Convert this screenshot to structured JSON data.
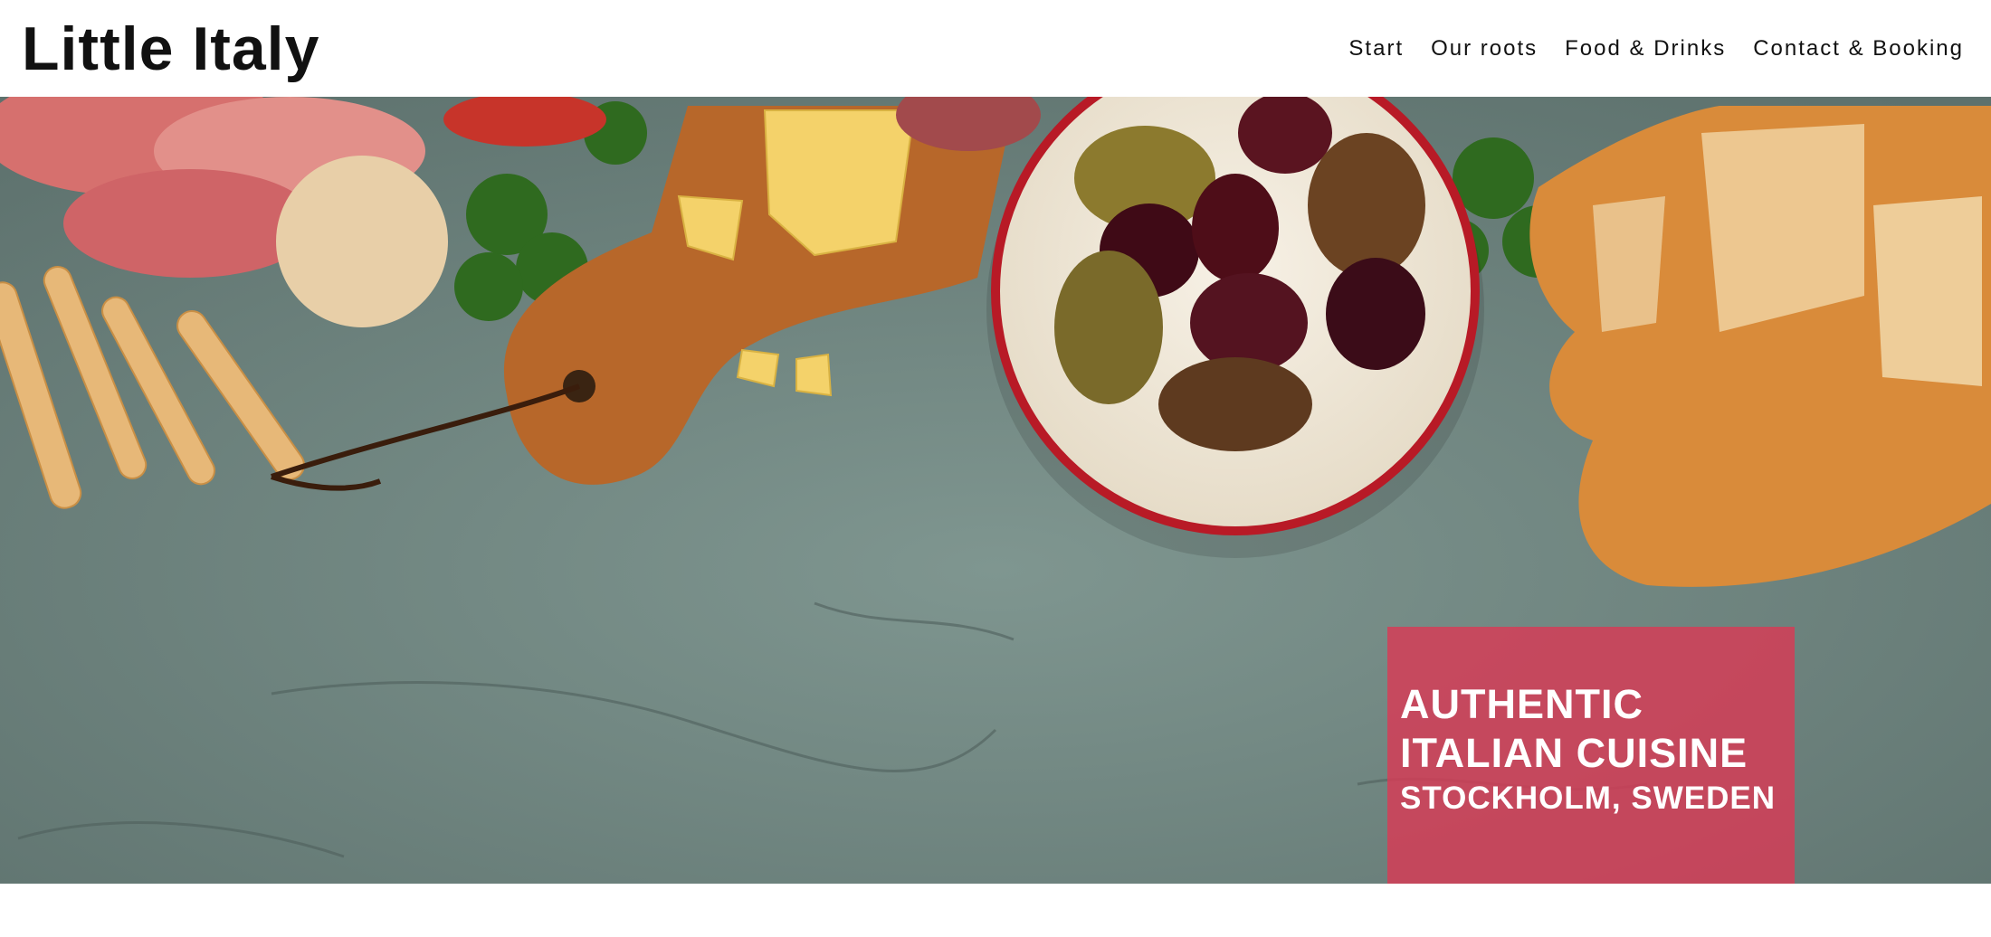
{
  "header": {
    "brand": "Little Italy",
    "nav": [
      "Start",
      "Our roots",
      "Food & Drinks",
      "Contact & Booking"
    ]
  },
  "hero": {
    "image_description_icon": "antipasti-photo",
    "promo": {
      "line1": "AUTHENTIC",
      "line2": "ITALIAN CUISINE",
      "line3": "STOCKHOLM, SWEDEN"
    }
  },
  "colors": {
    "promo_bg": "#d83a56",
    "slate": "#6f8782",
    "text": "#111111"
  }
}
